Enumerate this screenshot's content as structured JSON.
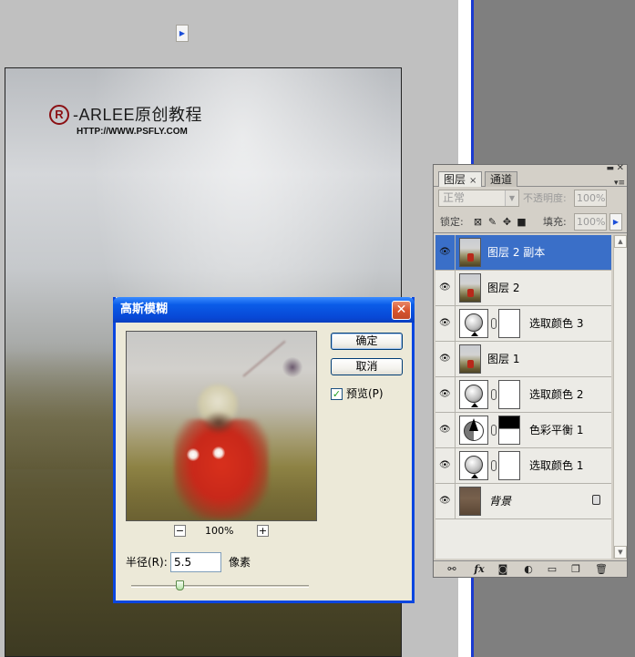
{
  "watermark": {
    "mark": "R",
    "title": "-ARLEE原创教程",
    "url": "HTTP://WWW.PSFLY.COM"
  },
  "dialog": {
    "title": "高斯模糊",
    "close": "✕",
    "ok_label": "确定",
    "cancel_label": "取消",
    "preview_label": "预览(P)",
    "preview_checked": "✓",
    "zoom_minus": "−",
    "zoom_plus": "+",
    "zoom_level": "100%",
    "radius_label": "半径(R):",
    "radius_value": "5.5",
    "radius_unit": "像素",
    "radius_slider_fraction": 0.27
  },
  "layers_panel": {
    "tabs": [
      {
        "label": "图层",
        "close": "×"
      },
      {
        "label": "通道"
      }
    ],
    "controls": {
      "minimize": "▬",
      "close": "✕",
      "menu": "▾≡"
    },
    "blend_mode": "正常",
    "opacity_label": "不透明度:",
    "opacity_value": "100%",
    "lock_label": "锁定:",
    "fill_label": "填充:",
    "fill_value": "100%",
    "layers": [
      {
        "name": "图层 2 副本",
        "selected": true
      },
      {
        "name": "图层 2"
      },
      {
        "name": "选取颜色 3"
      },
      {
        "name": "图层 1"
      },
      {
        "name": "选取颜色 2"
      },
      {
        "name": "色彩平衡 1"
      },
      {
        "name": "选取颜色 1"
      },
      {
        "name": "背景"
      }
    ]
  }
}
